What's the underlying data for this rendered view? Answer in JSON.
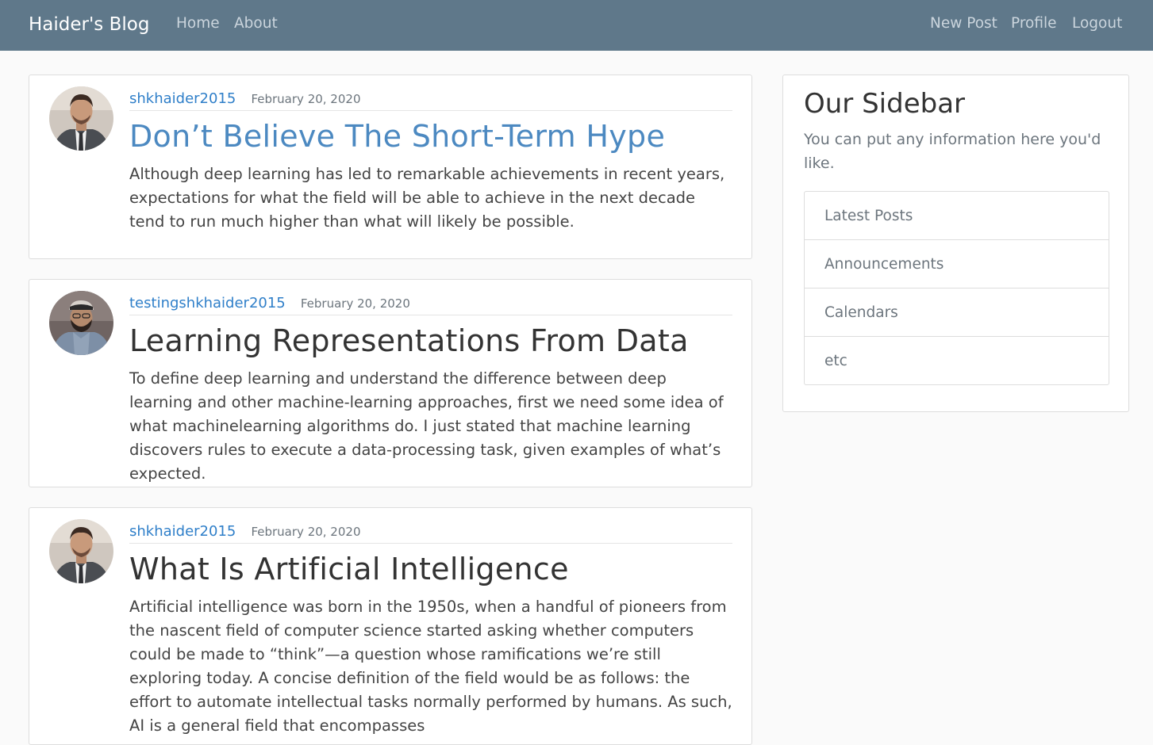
{
  "navbar": {
    "brand": "Haider's Blog",
    "left_links": [
      "Home",
      "About"
    ],
    "right_links": [
      "New Post",
      "Profile",
      "Logout"
    ],
    "background": "#5f788a"
  },
  "posts": [
    {
      "author": "shkhaider2015",
      "date": "February 20, 2020",
      "title": "Don’t Believe The Short-Term Hype",
      "content": "Although deep learning has led to remarkable achievements in recent years, expectations for what the field will be able to achieve in the next decade tend to run much higher than what will likely be possible."
    },
    {
      "author": "testingshkhaider2015",
      "date": "February 20, 2020",
      "title": "Learning Representations From Data",
      "content": "To define deep learning and understand the difference between deep learning and other machine-learning approaches, first we need some idea of what machinelearning algorithms do. I just stated that machine learning discovers rules to execute a data-processing task, given examples of what’s expected."
    },
    {
      "author": "shkhaider2015",
      "date": "February 20, 2020",
      "title": "What Is Artificial Intelligence",
      "content": "Artificial intelligence was born in the 1950s, when a handful of pioneers from the nascent field of computer science started asking whether computers could be made to “think”—a question whose ramifications we’re still exploring today. A concise definition of the field would be as follows: the effort to automate intellectual tasks normally performed by humans. As such, AI is a general field that encompasses"
    }
  ],
  "sidebar": {
    "title": "Our Sidebar",
    "text": "You can put any information here you'd like.",
    "items": [
      "Latest Posts",
      "Announcements",
      "Calendars",
      "etc"
    ]
  }
}
